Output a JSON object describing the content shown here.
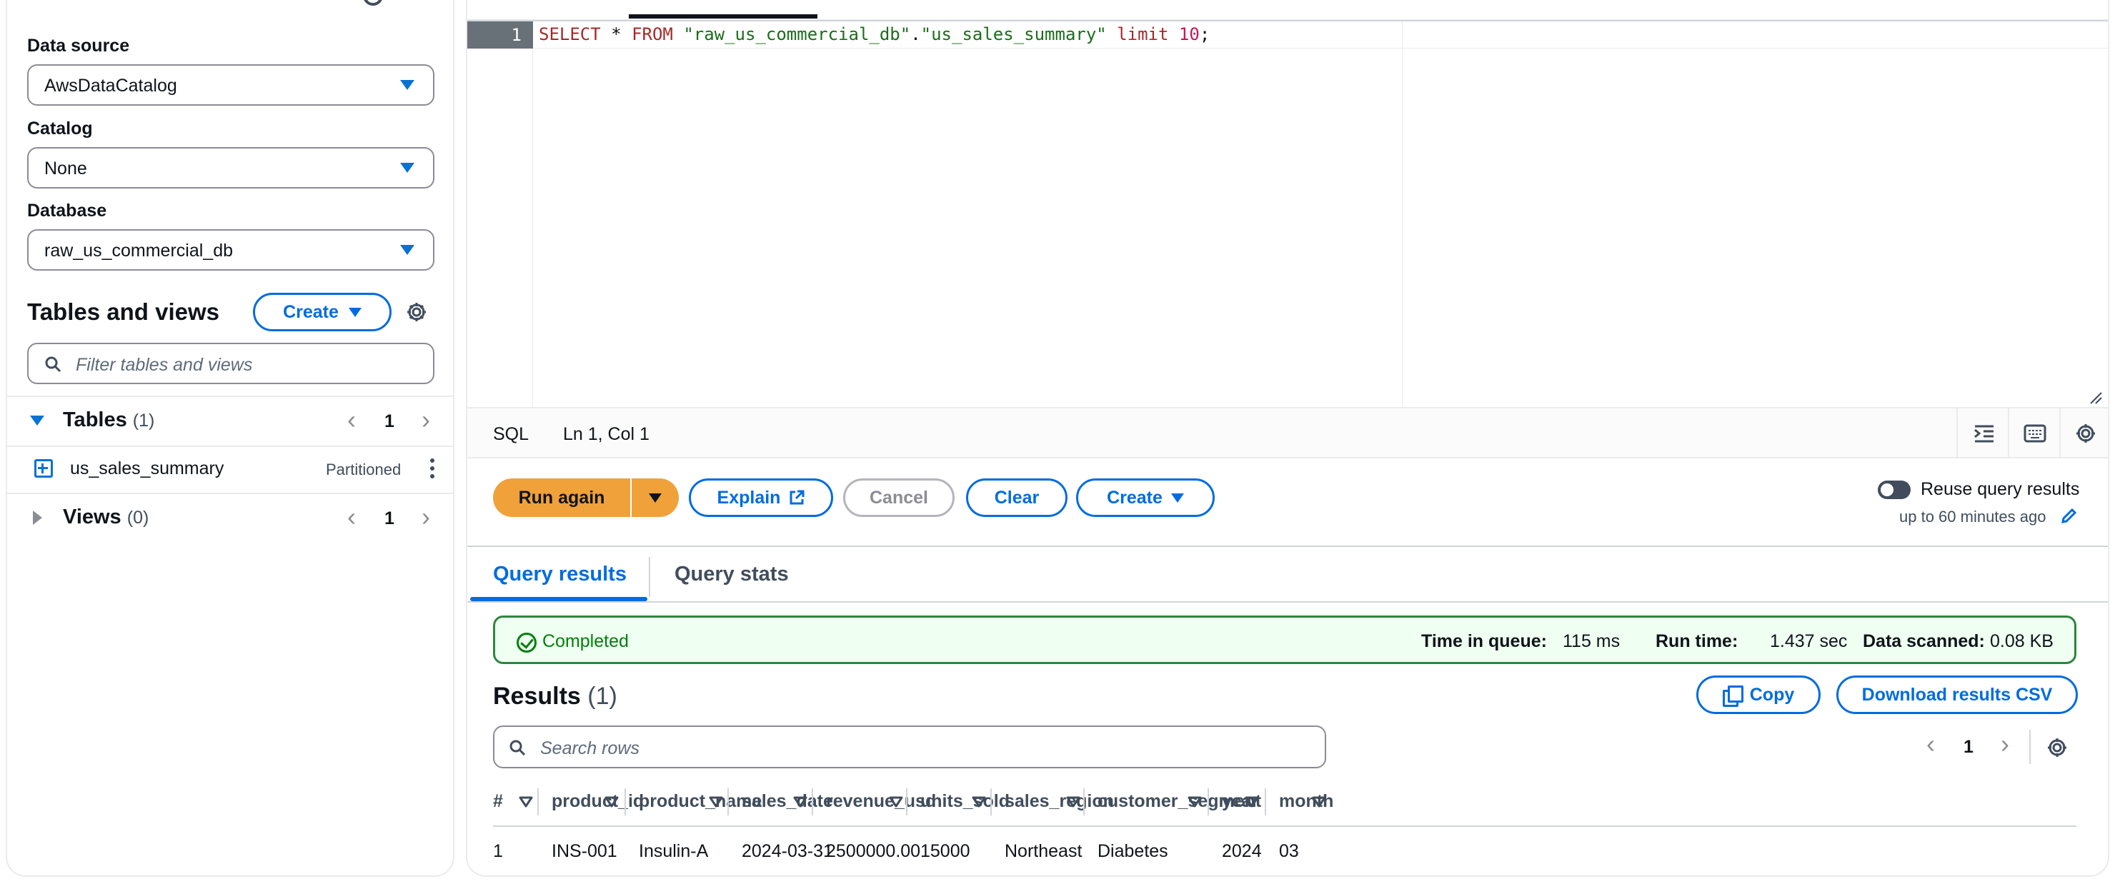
{
  "left": {
    "data_source": {
      "label": "Data source",
      "value": "AwsDataCatalog"
    },
    "catalog": {
      "label": "Catalog",
      "value": "None"
    },
    "database": {
      "label": "Database",
      "value": "raw_us_commercial_db"
    },
    "tables_and_views": {
      "heading": "Tables and views",
      "create_label": "Create",
      "filter_placeholder": "Filter tables and views"
    },
    "tables": {
      "title": "Tables",
      "count": "(1)",
      "page": "1",
      "items": [
        {
          "name": "us_sales_summary",
          "badge": "Partitioned"
        }
      ]
    },
    "views": {
      "title": "Views",
      "count": "(0)",
      "page": "1"
    }
  },
  "editor": {
    "line_number": "1",
    "query_tokens": {
      "t1": "SELECT",
      "t2": " * ",
      "t3": "FROM",
      "t4": " ",
      "t5": "\"raw_us_commercial_db\"",
      "t6": ".",
      "t7": "\"us_sales_summary\"",
      "t8": " ",
      "t9": "limit",
      "t10": " ",
      "t11": "10",
      "t12": ";"
    },
    "status_language": "SQL",
    "status_position": "Ln 1, Col 1"
  },
  "actions": {
    "run_again": "Run again",
    "explain": "Explain",
    "cancel": "Cancel",
    "clear": "Clear",
    "create": "Create",
    "reuse_label": "Reuse query results",
    "reuse_sub": "up to 60 minutes ago"
  },
  "tabs": {
    "query_results": "Query results",
    "query_stats": "Query stats"
  },
  "completion": {
    "status": "Completed",
    "time_in_queue_label": "Time in queue:",
    "time_in_queue_value": "115 ms",
    "run_time_label": "Run time:",
    "run_time_value": "1.437 sec",
    "data_scanned_label": "Data scanned:",
    "data_scanned_value": "0.08 KB"
  },
  "results": {
    "title": "Results",
    "count": "(1)",
    "copy": "Copy",
    "download": "Download results CSV",
    "search_placeholder": "Search rows",
    "page": "1",
    "columns": [
      "#",
      "product_id",
      "product_name",
      "sales_date",
      "revenue_usd",
      "units_sold",
      "sales_region",
      "customer_segment",
      "year",
      "month"
    ],
    "rows": [
      [
        "1",
        "INS-001",
        "Insulin-A",
        "2024-03-31",
        "2500000.00",
        "15000",
        "Northeast",
        "Diabetes",
        "2024",
        "03"
      ]
    ]
  },
  "colors": {
    "primary": "#006ce0",
    "run_button": "#f0a13a",
    "success": "#037f0c"
  }
}
